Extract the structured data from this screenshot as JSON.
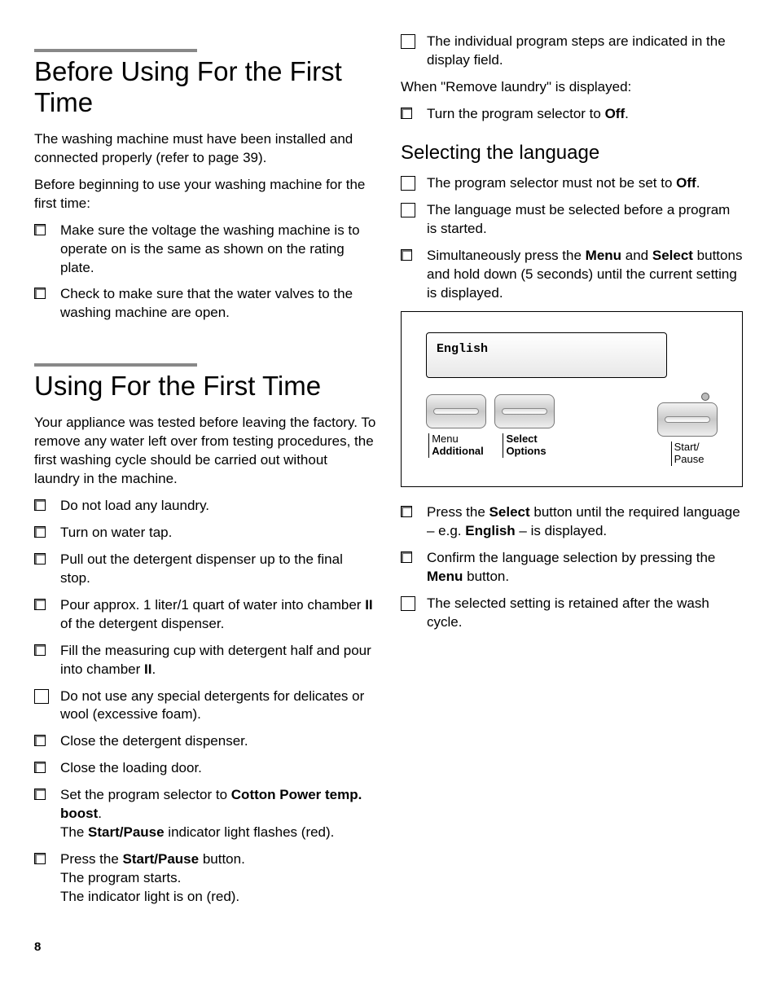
{
  "left": {
    "h1a": "Before Using For the First Time",
    "p1": "The washing machine must have been installed and connected properly (refer to page 39).",
    "p2": "Before beginning to use your washing machine for the first time:",
    "list1": [
      "Make sure the voltage the washing machine is to operate on is the same as shown on the rating plate.",
      "Check to make sure that the water valves to the washing machine are open."
    ],
    "h1b": "Using For the First Time",
    "p3": "Your appliance was tested before leaving the factory. To remove any water left over from testing procedures, the first washing cycle should be carried out without laundry in the machine.",
    "list2a": [
      "Do not load any laundry.",
      "Turn on water tap.",
      "Pull out the detergent dispenser up to the final stop."
    ],
    "li_pour_a": "Pour approx. 1 liter/1 quart of water into chamber ",
    "li_pour_b": "II",
    "li_pour_c": " of the detergent dispenser.",
    "li_fill_a": "Fill the measuring cup with detergent half and pour into chamber ",
    "li_fill_b": "II",
    "li_fill_c": ".",
    "note1": "Do not use any special detergents for delicates or wool (excessive foam).",
    "list2b": [
      "Close the detergent dispenser.",
      "Close the loading door."
    ],
    "li_set_a": "Set the program selector to ",
    "li_set_b": "Cotton Power temp. boost",
    "li_set_c": ".",
    "li_set_d": "The ",
    "li_set_e": "Start/Pause",
    "li_set_f": " indicator light flashes (red).",
    "li_press_a": "Press the ",
    "li_press_b": "Start/Pause",
    "li_press_c": " button.",
    "li_press_d": "The program starts.",
    "li_press_e": "The indicator light is on (red)."
  },
  "right": {
    "note_top": "The individual program steps are indicated in the display field.",
    "p1": "When \"Remove laundry\" is displayed:",
    "li_off_a": "Turn the program selector to ",
    "li_off_b": "Off",
    "li_off_c": ".",
    "h2": "Selecting the language",
    "note_off_a": "The program selector must not be set to ",
    "note_off_b": "Off",
    "note_off_c": ".",
    "note_lang": "The language must be selected before a program is started.",
    "li_sim_a": "Simultaneously press the ",
    "li_sim_b": "Menu",
    "li_sim_c": " and ",
    "li_sim_d": "Select",
    "li_sim_e": " buttons and hold down (5 seconds) until the current setting is displayed.",
    "panel": {
      "lcd": "English",
      "menu1": "Menu",
      "menu2": "Additional",
      "select1": "Select",
      "select2": "Options",
      "start1": "Start/",
      "start2": "Pause"
    },
    "li_sel_a": "Press the ",
    "li_sel_b": "Select",
    "li_sel_c": " button until the required language – e.g. ",
    "li_sel_d": "English",
    "li_sel_e": " – is displayed.",
    "li_conf_a": "Confirm the language selection by pressing the ",
    "li_conf_b": "Menu",
    "li_conf_c": " button.",
    "note_retain": "The selected setting is retained after the wash cycle."
  },
  "page": "8"
}
